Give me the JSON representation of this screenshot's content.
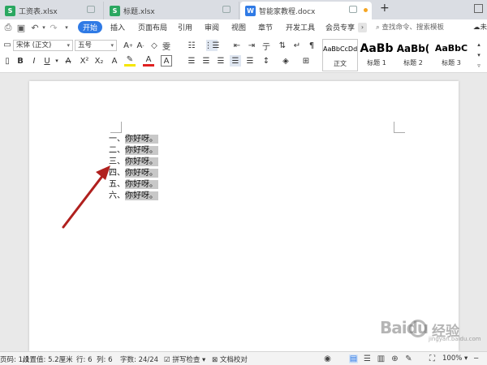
{
  "tabs": [
    {
      "label": "工资表.xlsx",
      "icon": "spreadsheet-icon",
      "active": false
    },
    {
      "label": "标题.xlsx",
      "icon": "spreadsheet-icon",
      "active": false
    },
    {
      "label": "智能家教程.docx",
      "icon": "writer-doc-icon",
      "active": true
    }
  ],
  "menu": {
    "items": [
      "开始",
      "插入",
      "页面布局",
      "引用",
      "审阅",
      "视图",
      "章节",
      "开发工具",
      "会员专享"
    ],
    "active": "开始",
    "search_placeholder": "查找命令、搜索模板",
    "right_label": "未同"
  },
  "toolbar": {
    "font_name": "宋体 (正文)",
    "font_size": "五号",
    "styles": [
      {
        "sample": "AaBbCcDd",
        "name": "正文",
        "selected": true
      },
      {
        "sample": "AaBb",
        "name": "标题 1",
        "selected": false
      },
      {
        "sample": "AaBb(",
        "name": "标题 2",
        "selected": false
      },
      {
        "sample": "AaBbC",
        "name": "标题 3",
        "selected": false
      }
    ],
    "colors": {
      "highlight": "#f5e600",
      "font_color": "#e02020",
      "accent": "#2f7ae5"
    }
  },
  "document": {
    "list_items": [
      {
        "num": "一、",
        "text": "你好呀。"
      },
      {
        "num": "二、",
        "text": "你好呀。"
      },
      {
        "num": "三、",
        "text": "你好呀。"
      },
      {
        "num": "四、",
        "text": "你好呀。"
      },
      {
        "num": "五、",
        "text": "你好呀。"
      },
      {
        "num": "六、",
        "text": "你好呀。"
      }
    ],
    "annotation_color": "#b0201e"
  },
  "status": {
    "page": "页码: 1/1",
    "position": "设置值: 5.2厘米",
    "row": "行: 6",
    "col": "列: 6",
    "word_count": "字数: 24/24",
    "spell_check": "拼写检查",
    "doc_check": "文档校对",
    "zoom": "100%"
  },
  "watermark": {
    "logo": "Baidu",
    "text": "经验",
    "sub": "jingyan.baidu.com"
  }
}
